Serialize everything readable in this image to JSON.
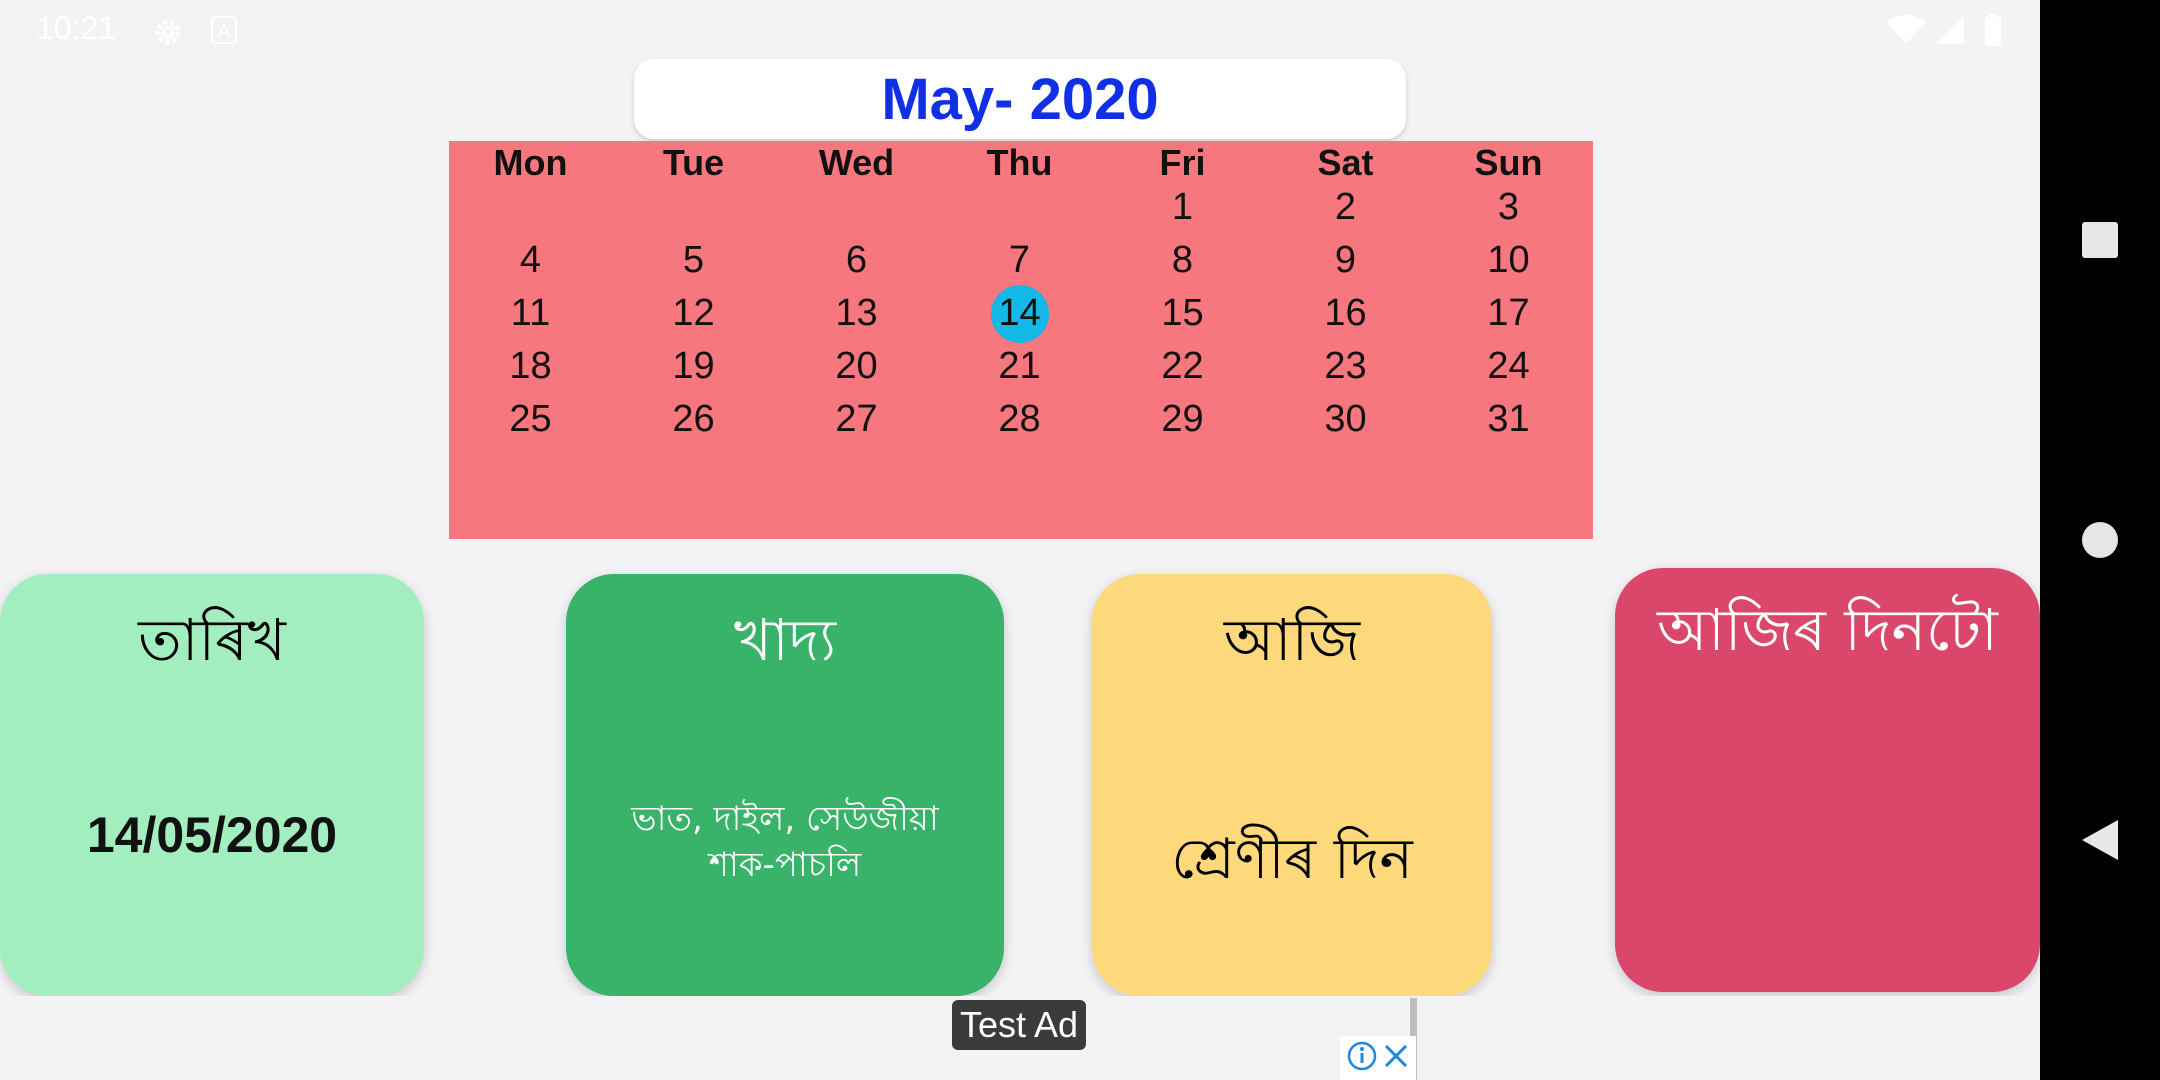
{
  "status_bar": {
    "time": "10:21",
    "icons": [
      "settings-icon",
      "a-notification-icon",
      "wifi-icon",
      "cell-signal-icon",
      "battery-icon"
    ]
  },
  "calendar": {
    "title": "May- 2020",
    "weekdays": [
      "Mon",
      "Tue",
      "Wed",
      "Thu",
      "Fri",
      "Sat",
      "Sun"
    ],
    "weeks": [
      [
        "",
        "",
        "",
        "",
        "1",
        "2",
        "3"
      ],
      [
        "4",
        "5",
        "6",
        "7",
        "8",
        "9",
        "10"
      ],
      [
        "11",
        "12",
        "13",
        "14",
        "15",
        "16",
        "17"
      ],
      [
        "18",
        "19",
        "20",
        "21",
        "22",
        "23",
        "24"
      ],
      [
        "25",
        "26",
        "27",
        "28",
        "29",
        "30",
        "31"
      ]
    ],
    "today": "14",
    "colors": {
      "background": "#f7777e",
      "today": "#14b8e6",
      "title": "#1130e6"
    }
  },
  "cards": [
    {
      "title": "তাৰিখ",
      "value": "14/05/2020",
      "color": "#a2eebe"
    },
    {
      "title": "খাদ্য",
      "value": "ভাত, দাইল, সেউজীয়া শাক-পাচলি",
      "color": "#39b26a"
    },
    {
      "title": "আজি",
      "value": "শ্ৰেণীৰ দিন",
      "color": "#fed97c"
    },
    {
      "title": "আজিৰ দিনটো",
      "value": "",
      "color": "#db476b"
    }
  ],
  "ad": {
    "label": "Test Ad",
    "icons": [
      "ad-info-icon",
      "ad-close-icon"
    ]
  },
  "nav_bar": {
    "buttons": [
      "recents-icon",
      "home-icon",
      "back-icon"
    ]
  }
}
